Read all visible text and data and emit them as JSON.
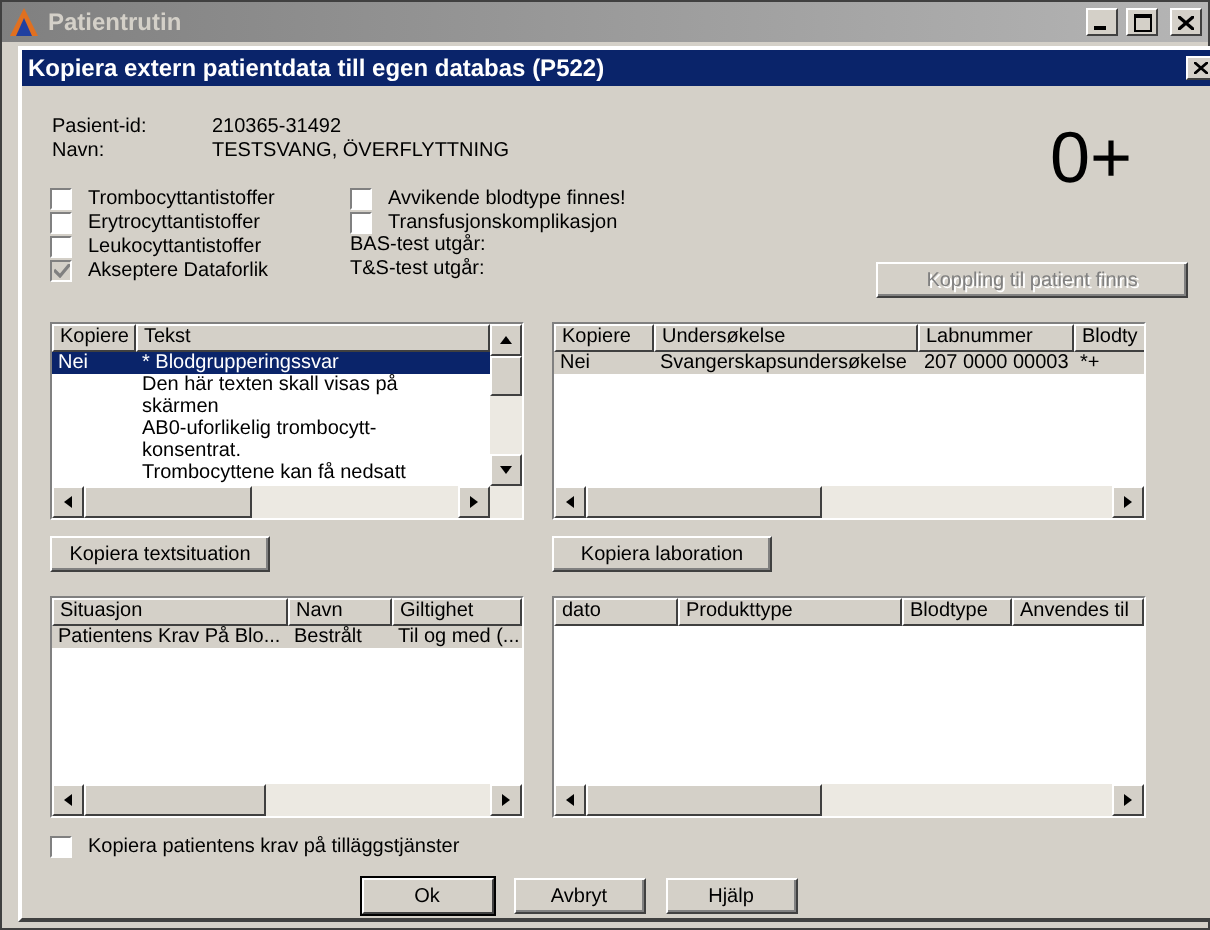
{
  "window": {
    "title": "Patientrutin"
  },
  "dialog": {
    "title": "Kopiera extern patientdata till egen databas (P522)"
  },
  "patient": [
    {
      "label": "Pasient-id:",
      "value": "210365-31492"
    },
    {
      "label": "Navn:",
      "value": "TESTSVANG, ÖVERFLYTTNING"
    }
  ],
  "blood_type": "0+",
  "checks_left": [
    {
      "label": "Trombocyttantistoffer",
      "checked": false,
      "disabled": false
    },
    {
      "label": "Erytrocyttantistoffer",
      "checked": false,
      "disabled": false
    },
    {
      "label": "Leukocyttantistoffer",
      "checked": false,
      "disabled": false
    },
    {
      "label": "Akseptere Dataforlik",
      "checked": true,
      "disabled": true
    }
  ],
  "checks_right": [
    {
      "label": "Avvikende blodtype finnes!",
      "checked": false,
      "disabled": false
    },
    {
      "label": "Transfusjonskomplikasjon",
      "checked": false,
      "disabled": false
    }
  ],
  "test_labels": [
    "BAS-test utgår:",
    "T&S-test utgår:"
  ],
  "link_button": {
    "label": "Koppling til patient finns",
    "disabled": true
  },
  "lists": [
    {
      "focused": true,
      "vscroll": true,
      "columns": [
        "Kopiere",
        "Tekst"
      ],
      "rows": [
        {
          "kind": "entry",
          "selected": true,
          "cells": [
            "Nei",
            "* Blodgrupperingssvar"
          ]
        },
        {
          "kind": "wrap",
          "selected": false,
          "text": "Den här texten skall visas på"
        },
        {
          "kind": "wrap",
          "selected": false,
          "text": "skärmen"
        },
        {
          "kind": "wrap",
          "selected": false,
          "text": "AB0-uforlikelig trombocytt-"
        },
        {
          "kind": "wrap",
          "selected": false,
          "text": "konsentrat."
        },
        {
          "kind": "wrap",
          "selected": false,
          "text": "Trombocyttene kan få nedsatt"
        }
      ],
      "button": "Kopiera textsituation"
    },
    {
      "focused": false,
      "vscroll": false,
      "columns": [
        "Kopiere",
        "Undersøkelse",
        "Labnummer",
        "Blodty"
      ],
      "rows": [
        {
          "kind": "entry",
          "selected": true,
          "cells": [
            "Nei",
            "Svangerskapsundersøkelse",
            "207 0000 00003",
            "*+"
          ]
        }
      ],
      "button": "Kopiera laboration"
    },
    {
      "focused": false,
      "vscroll": false,
      "columns": [
        "Situasjon",
        "Navn",
        "Giltighet"
      ],
      "rows": [
        {
          "kind": "entry",
          "selected": true,
          "cells": [
            "Patientens Krav På Blo...",
            "Bestrålt",
            "Til og med (..."
          ]
        }
      ]
    },
    {
      "vscroll": false,
      "columns": [
        "dato",
        "Produkttype",
        "Blodtype",
        "Anvendes til"
      ]
    }
  ],
  "copy_requirements": {
    "label": "Kopiera patientens krav på tilläggstjänster",
    "checked": false
  },
  "buttons": [
    {
      "label": "Ok",
      "default": true
    },
    {
      "label": "Avbryt",
      "default": false
    },
    {
      "label": "Hjälp",
      "default": false
    }
  ]
}
